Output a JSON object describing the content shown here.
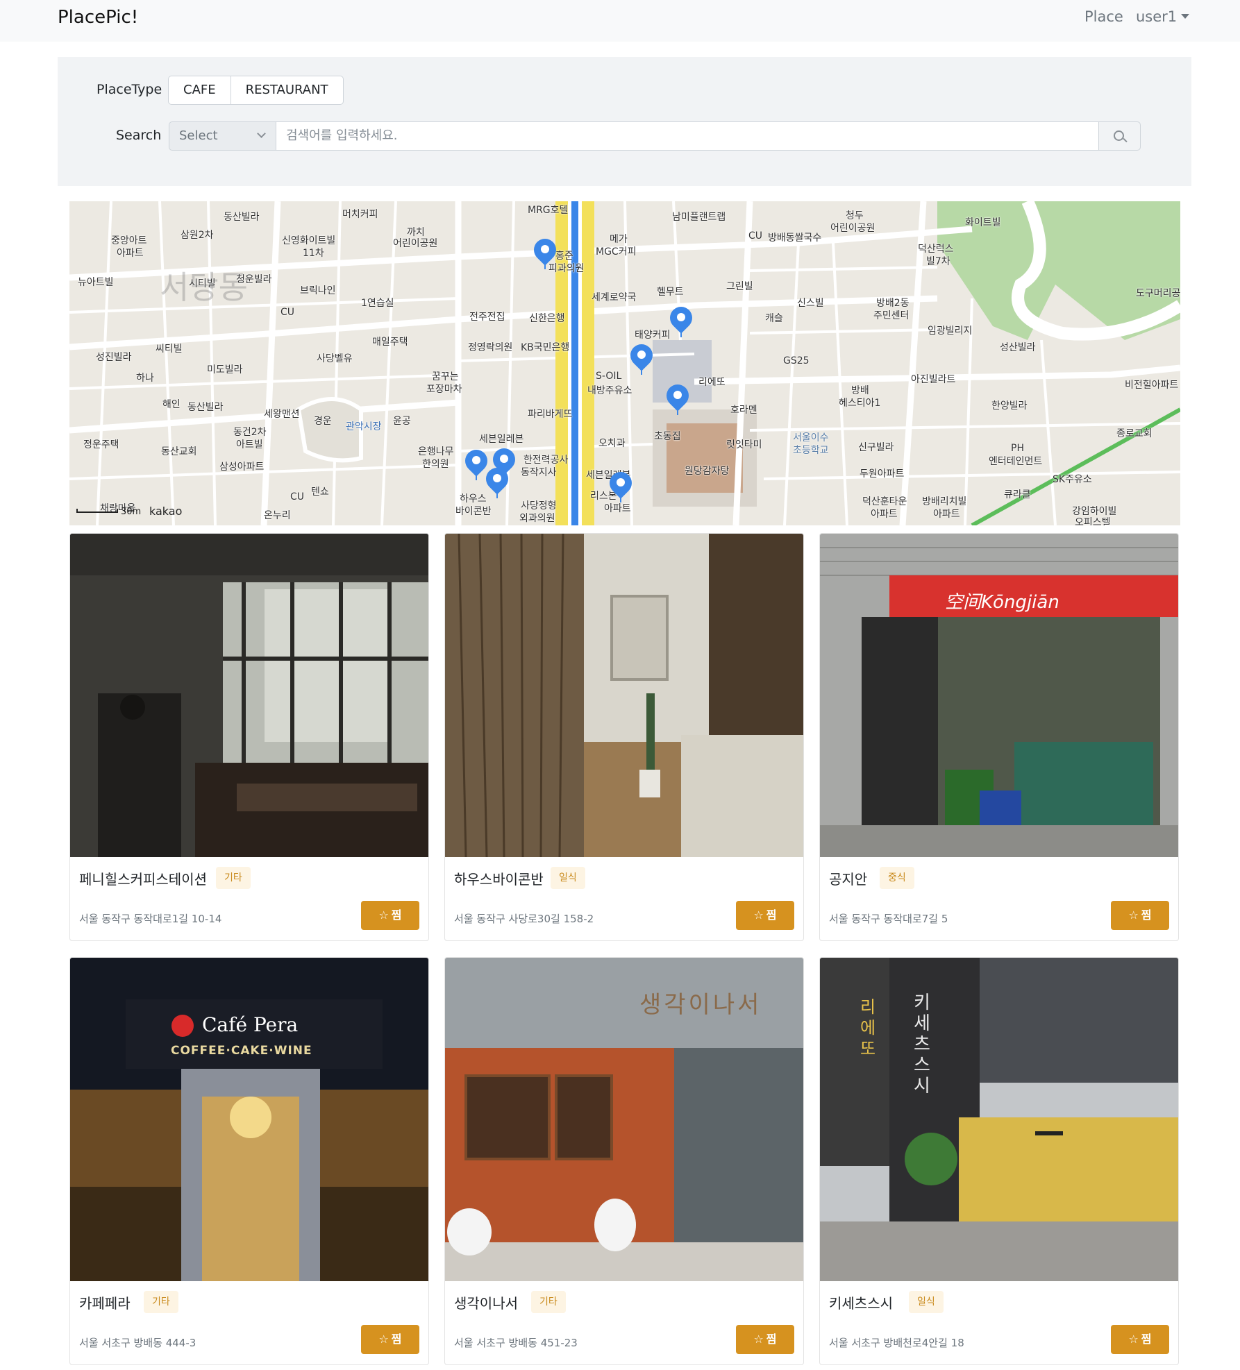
{
  "navbar": {
    "brand": "PlacePic!",
    "place_link": "Place",
    "user_menu": "user1"
  },
  "filter": {
    "place_type_label": "PlaceType",
    "place_types": [
      "CAFE",
      "RESTAURANT"
    ],
    "search_label": "Search",
    "select_value": "Select",
    "search_placeholder": "검색어를 입력하세요."
  },
  "map": {
    "district": "서당동",
    "attribution": "kakao",
    "scale": "30m",
    "labels": {
      "l0": "동산빌라",
      "l1": "삼원2차",
      "l2": "머치커피",
      "l3": "중앙아트",
      "l4": "아파트",
      "l5": "신영화이트빌",
      "l6": "11차",
      "l7": "까치",
      "l8": "어린이공원",
      "l9": "뉴아트빌",
      "l10": "시티빌",
      "l11": "청운빌라",
      "l12": "브릭나인",
      "l13": "CU",
      "l14": "1연습실",
      "l15": "성진빌라",
      "l16": "씨티빌",
      "l17": "하나",
      "l18": "매일주택",
      "l19": "사당벨유",
      "l20": "미도빌라",
      "l21": "해인",
      "l22": "동산빌라",
      "l23": "세왕맨션",
      "l24": "경운",
      "l25": "관악시장",
      "l26": "윤공",
      "l27": "동건2차",
      "l28": "아트빌",
      "l29": "정운주택",
      "l30": "동산교회",
      "l31": "삼성아파트",
      "l32": "CU",
      "l33": "텐쇼",
      "l34": "채랑마을",
      "l35": "온누리",
      "l36": "MRG호텔",
      "l37": "메가",
      "l38": "MGC커피",
      "l39": "홍준",
      "l40": "피과의원",
      "l41": "세계로약국",
      "l42": "전주전집",
      "l43": "신한은행",
      "l44": "정영락의원",
      "l45": "KB국민은행",
      "l46": "태양커피",
      "l47": "꿈꾸는",
      "l48": "포장마차",
      "l49": "S-OIL",
      "l50": "내방주유소",
      "l51": "파리바게뜨",
      "l52": "세븐일레븐",
      "l53": "은행나무",
      "l54": "한의원",
      "l55": "오치과",
      "l56": "한전력공사",
      "l57": "동작지사",
      "l58": "세븐일레븐",
      "l59": "하우스",
      "l60": "바이콘반",
      "l61": "사당정형",
      "l62": "외과의원",
      "l63": "리스본",
      "l64": "아파트",
      "l65": "남미플랜트랩",
      "l66": "CU",
      "l67": "방배동쌀국수",
      "l68": "청두",
      "l69": "어린이공원",
      "l70": "헬무트",
      "l71": "그린빌",
      "l72": "캐슬",
      "l73": "신스빌",
      "l74": "GS25",
      "l75": "리에또",
      "l76": "호라멘",
      "l77": "릿잇타미",
      "l78": "초동집",
      "l79": "원당감자탕",
      "l80": "서울이수",
      "l81": "초등학교",
      "l82": "방배",
      "l83": "헤스티아1",
      "l84": "화이트빌",
      "l85": "덕산럭스",
      "l86": "빌7차",
      "l87": "방배2동",
      "l88": "주민센터",
      "l89": "임광빌리지",
      "l90": "성산빌라",
      "l91": "도구머리공원",
      "l92": "아진빌라트",
      "l93": "비전힐아파트",
      "l94": "한양빌라",
      "l95": "종로교회",
      "l96": "신구빌라",
      "l97": "PH",
      "l98": "엔터테인먼트",
      "l99": "SK주유소",
      "l100": "두원아파트",
      "l101": "큐라클",
      "l102": "덕산훈타운",
      "l103": "아파트",
      "l104": "방배리치빌",
      "l105": "아파트",
      "l106": "강임하이빌",
      "l107": "오피스텔"
    }
  },
  "places": [
    {
      "name": "페니힐스커피스테이션",
      "category": "기타",
      "address": "서울 동작구 동작대로1길 10-14",
      "button": "찜"
    },
    {
      "name": "하우스바이콘반",
      "category": "일식",
      "address": "서울 동작구 사당로30길 158-2",
      "button": "찜"
    },
    {
      "name": "공지안",
      "category": "중식",
      "address": "서울 동작구 동작대로7길 5",
      "button": "찜"
    },
    {
      "name": "카페페라",
      "category": "기타",
      "address": "서울 서초구 방배동 444-3",
      "button": "찜"
    },
    {
      "name": "생각이나서",
      "category": "기타",
      "address": "서울 서초구 방배동 451-23",
      "button": "찜"
    },
    {
      "name": "키세츠스시",
      "category": "일식",
      "address": "서울 서초구 방배천로4안길 18",
      "button": "찜"
    }
  ],
  "photo_signs": {
    "kongjian": "空间Kōngjiān",
    "pera_title": "Café Pera",
    "pera_sub": "COFFEE·CAKE·WINE",
    "saenggak": "생각이나서",
    "kisetsu": "키세츠스시",
    "rieto": "리에또"
  },
  "colors": {
    "accent": "#d6921f",
    "badge_text": "#c98a1c",
    "pin": "#3a86e8",
    "park": "#b7d9a6",
    "subway_line": "#e9d64a"
  }
}
